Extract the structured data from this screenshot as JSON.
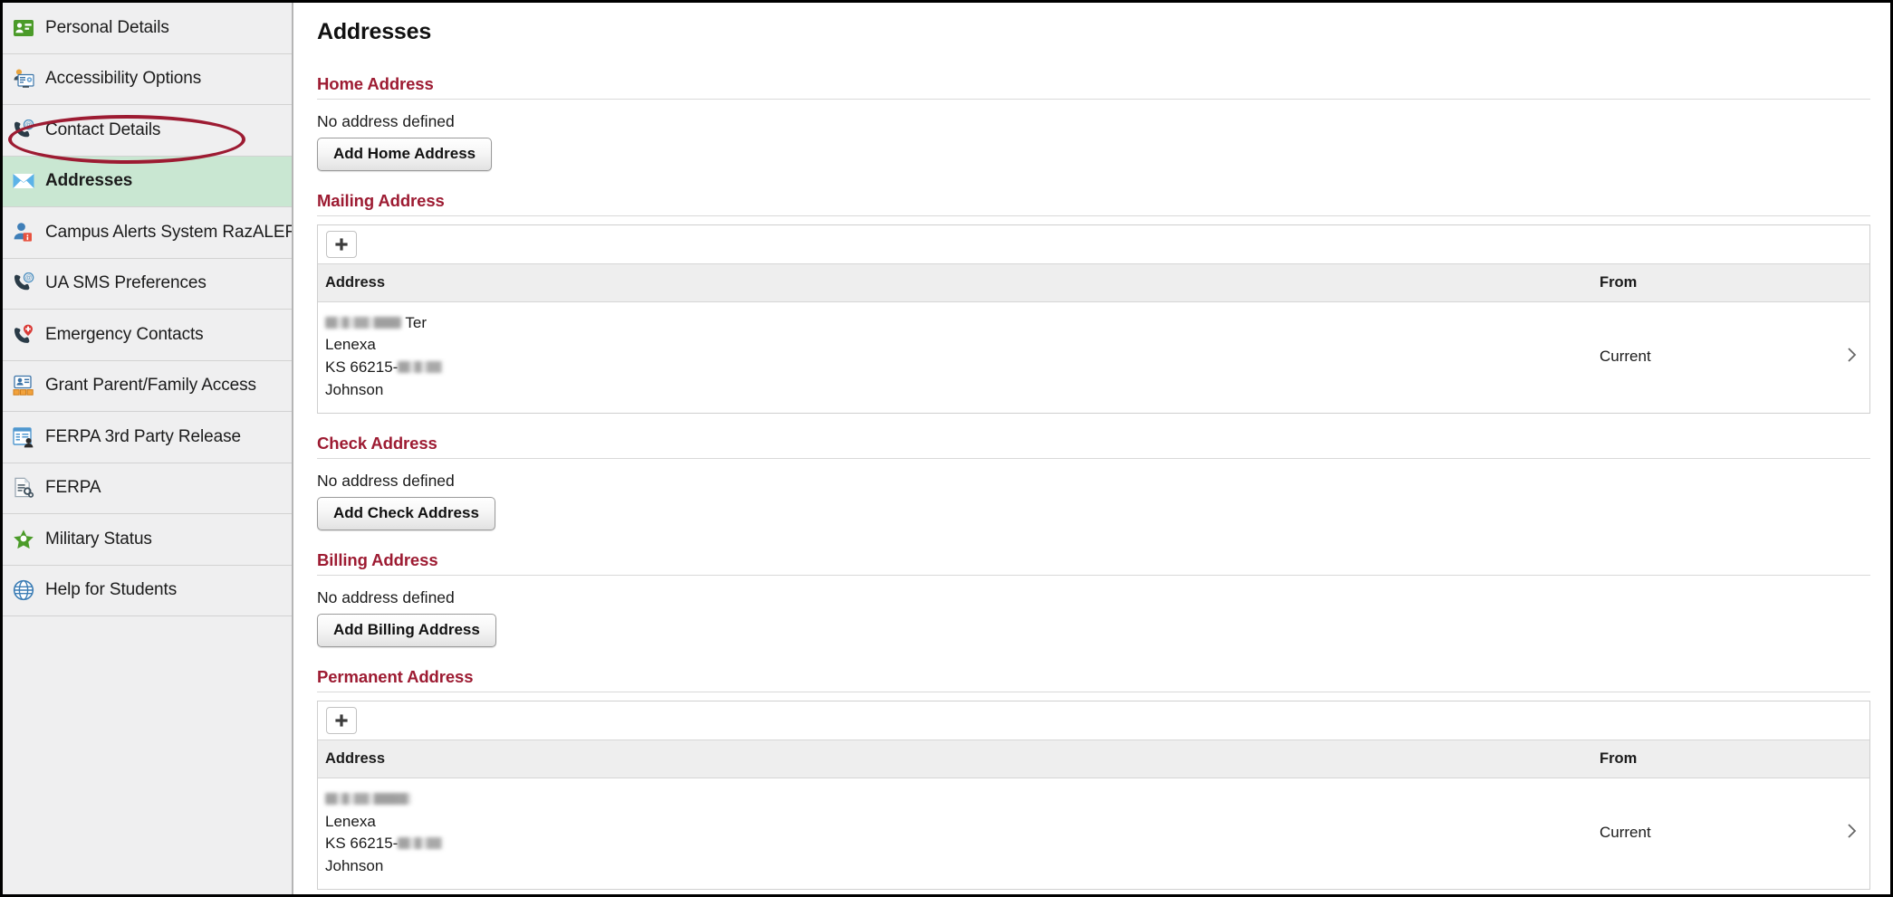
{
  "app": {
    "page_title": "Addresses"
  },
  "sidebar": {
    "items": [
      {
        "label": "Personal Details",
        "icon": "personal-details-icon",
        "selected": false
      },
      {
        "label": "Accessibility Options",
        "icon": "accessibility-options-icon",
        "selected": false
      },
      {
        "label": "Contact Details",
        "icon": "contact-details-icon",
        "selected": false
      },
      {
        "label": "Addresses",
        "icon": "addresses-envelope-icon",
        "selected": true
      },
      {
        "label": "Campus Alerts System RazALERT",
        "icon": "campus-alerts-icon",
        "selected": false
      },
      {
        "label": "UA SMS Preferences",
        "icon": "sms-preferences-icon",
        "selected": false
      },
      {
        "label": "Emergency Contacts",
        "icon": "emergency-contacts-icon",
        "selected": false
      },
      {
        "label": "Grant Parent/Family Access",
        "icon": "grant-access-icon",
        "selected": false
      },
      {
        "label": "FERPA 3rd Party Release",
        "icon": "ferpa-release-icon",
        "selected": false
      },
      {
        "label": "FERPA",
        "icon": "ferpa-icon",
        "selected": false
      },
      {
        "label": "Military Status",
        "icon": "military-status-icon",
        "selected": false
      },
      {
        "label": "Help for Students",
        "icon": "help-globe-icon",
        "selected": false
      }
    ]
  },
  "annotation": {
    "type": "ellipse-highlight",
    "target": "Addresses",
    "color": "#9d1b32"
  },
  "colors": {
    "accent_heading": "#9d1b32",
    "selected_row": "#c9e7d2",
    "sidebar_bg": "#efeff0",
    "table_header_bg": "#eeeeee"
  },
  "sections": {
    "home": {
      "heading": "Home Address",
      "empty_text": "No address defined",
      "button_label": "Add Home Address"
    },
    "mailing": {
      "heading": "Mailing Address",
      "add_icon": "plus-icon",
      "columns": {
        "address": "Address",
        "from": "From"
      },
      "rows": [
        {
          "line1_redacted": true,
          "line1_suffix": "Ter",
          "city": "Lenexa",
          "state_zip_prefix": "KS 66215-",
          "zip_redacted": true,
          "county": "Johnson",
          "from": "Current",
          "chevron": "chevron-right-icon"
        }
      ]
    },
    "check": {
      "heading": "Check Address",
      "empty_text": "No address defined",
      "button_label": "Add Check Address"
    },
    "billing": {
      "heading": "Billing Address",
      "empty_text": "No address defined",
      "button_label": "Add Billing Address"
    },
    "permanent": {
      "heading": "Permanent Address",
      "add_icon": "plus-icon",
      "columns": {
        "address": "Address",
        "from": "From"
      },
      "rows": [
        {
          "line1_redacted": true,
          "line1_suffix": "",
          "city": "Lenexa",
          "state_zip_prefix": "KS 66215-",
          "zip_redacted": true,
          "county": "Johnson",
          "from": "Current",
          "chevron": "chevron-right-icon"
        }
      ]
    }
  }
}
